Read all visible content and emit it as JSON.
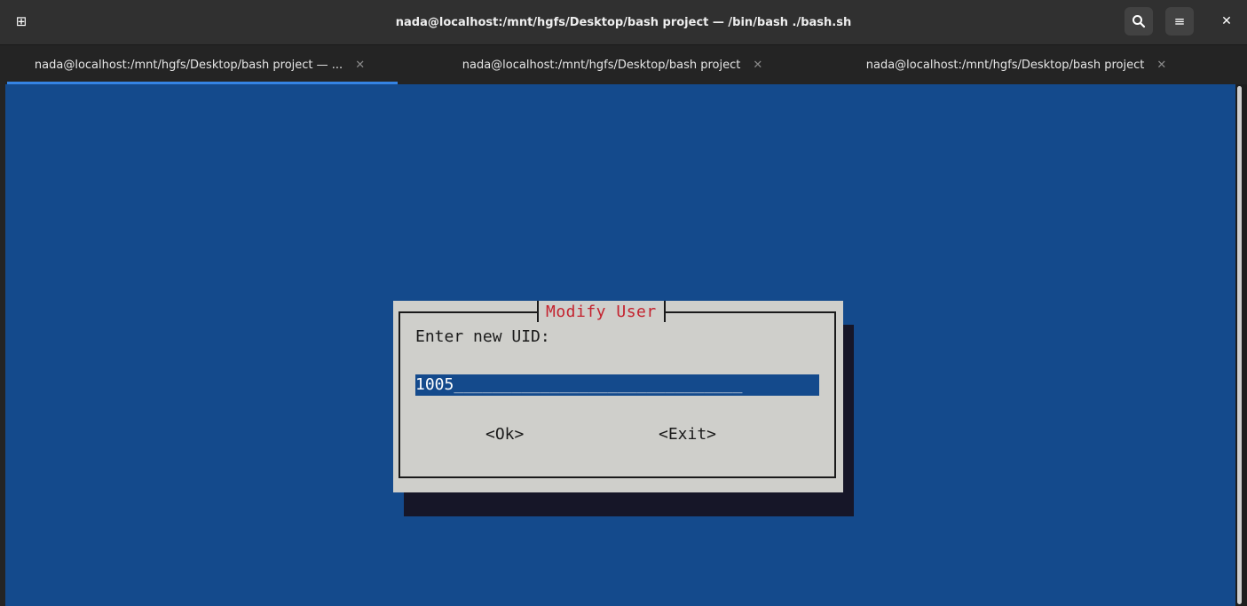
{
  "window": {
    "title": "nada@localhost:/mnt/hgfs/Desktop/bash project — /bin/bash ./bash.sh",
    "new_tab_icon": "new-tab-icon",
    "search_icon": "search-icon",
    "menu_icon": "hamburger-menu-icon",
    "close_icon": "close-icon",
    "new_tab_glyph": "⊞",
    "search_glyph": "🔍",
    "menu_glyph": "≡",
    "close_glyph": "✕"
  },
  "tabs": [
    {
      "label": "nada@localhost:/mnt/hgfs/Desktop/bash project — ...",
      "close": "✕",
      "active": true
    },
    {
      "label": "nada@localhost:/mnt/hgfs/Desktop/bash project",
      "close": "✕",
      "active": false
    },
    {
      "label": "nada@localhost:/mnt/hgfs/Desktop/bash project",
      "close": "✕",
      "active": false
    }
  ],
  "tabs_dropdown_glyph": "▼",
  "dialog": {
    "title": "Modify User",
    "prompt": "Enter new UID:",
    "input_value": "1005",
    "input_fill": "______________________________",
    "ok_label": "<Ok>",
    "exit_label": "<Exit>"
  },
  "colors": {
    "terminal_bg": "#144a8c",
    "dialog_bg": "#cfcfcb",
    "title_color": "#c4232f",
    "accent": "#3584e4"
  }
}
